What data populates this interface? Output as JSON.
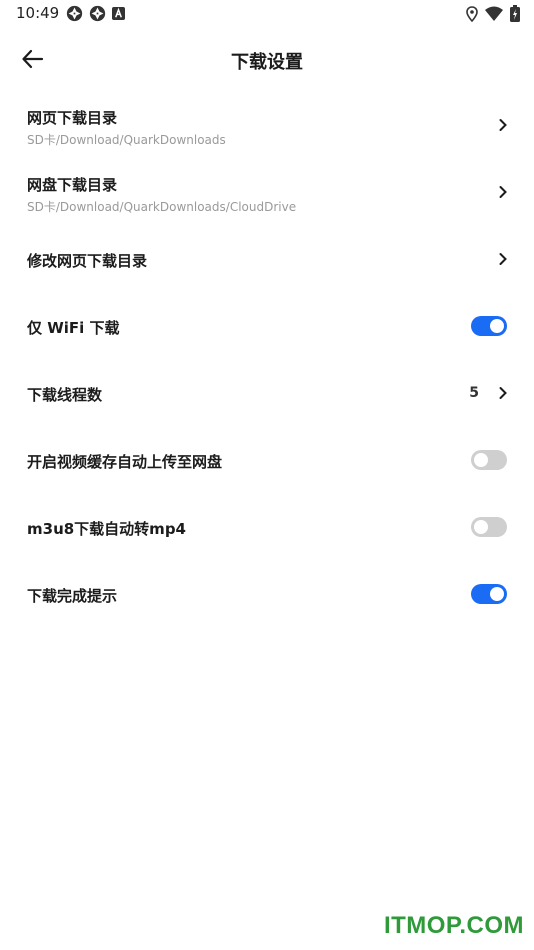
{
  "status_bar": {
    "time": "10:49"
  },
  "header": {
    "title": "下载设置",
    "back_icon": "arrow-left-icon"
  },
  "settings": [
    {
      "title": "网页下载目录",
      "subtitle": "SD卡/Download/QuarkDownloads",
      "control": "chevron"
    },
    {
      "title": "网盘下载目录",
      "subtitle": "SD卡/Download/QuarkDownloads/CloudDrive",
      "control": "chevron"
    },
    {
      "title": "修改网页下载目录",
      "control": "chevron"
    },
    {
      "title": "仅 WiFi 下载",
      "control": "toggle",
      "on": true
    },
    {
      "title": "下载线程数",
      "value": "5",
      "control": "chevron"
    },
    {
      "title": "开启视频缓存自动上传至网盘",
      "control": "toggle",
      "on": false
    },
    {
      "title": "m3u8下载自动转mp4",
      "control": "toggle",
      "on": false
    },
    {
      "title": "下载完成提示",
      "control": "toggle",
      "on": true
    }
  ],
  "colors": {
    "toggle_on": "#1a6cf5",
    "toggle_off": "#cfcfcf",
    "watermark": "#2f9a3a"
  },
  "watermark": "ITMOP.COM"
}
